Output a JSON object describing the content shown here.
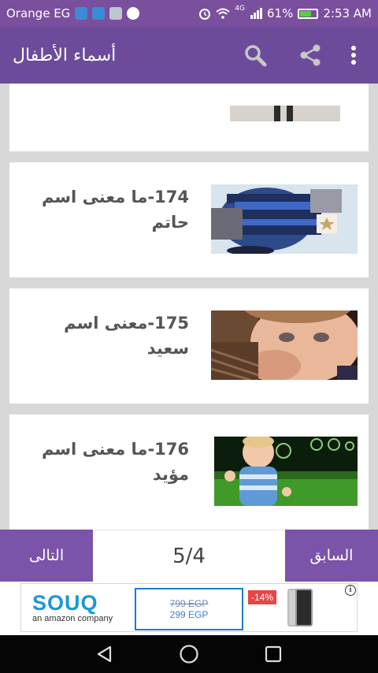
{
  "status_bar": {
    "carrier": "Orange EG",
    "network": "4G",
    "battery": "61%",
    "time": "2:53 AM"
  },
  "app_bar": {
    "title": "أسماء الأطفال",
    "icons": [
      "search-icon",
      "share-icon",
      "more-vert-icon"
    ]
  },
  "list": {
    "items": [
      {
        "title": "",
        "thumb": "partial-photo"
      },
      {
        "title": "174-ما معنى اسم حاتم",
        "thumb": "baby-striped-sweater"
      },
      {
        "title": "175-معنى اسم سعيد",
        "thumb": "baby-crying"
      },
      {
        "title": "176-ما معنى اسم مؤيد",
        "thumb": "toddler-bubbles"
      }
    ]
  },
  "pager": {
    "next_label": "التالى",
    "page_indicator": "5/4",
    "prev_label": "السابق"
  },
  "ad": {
    "brand": "SOUQ",
    "tagline": "an amazon company",
    "old_price": "799 EGP",
    "new_price": "299 EGP",
    "discount": "-14%",
    "info_mark": "i"
  },
  "colors": {
    "status_bar": "#7a4f9e",
    "app_bar": "#6c4c9a",
    "pager_button": "#7b53a8",
    "souq_blue": "#1a97d5"
  }
}
